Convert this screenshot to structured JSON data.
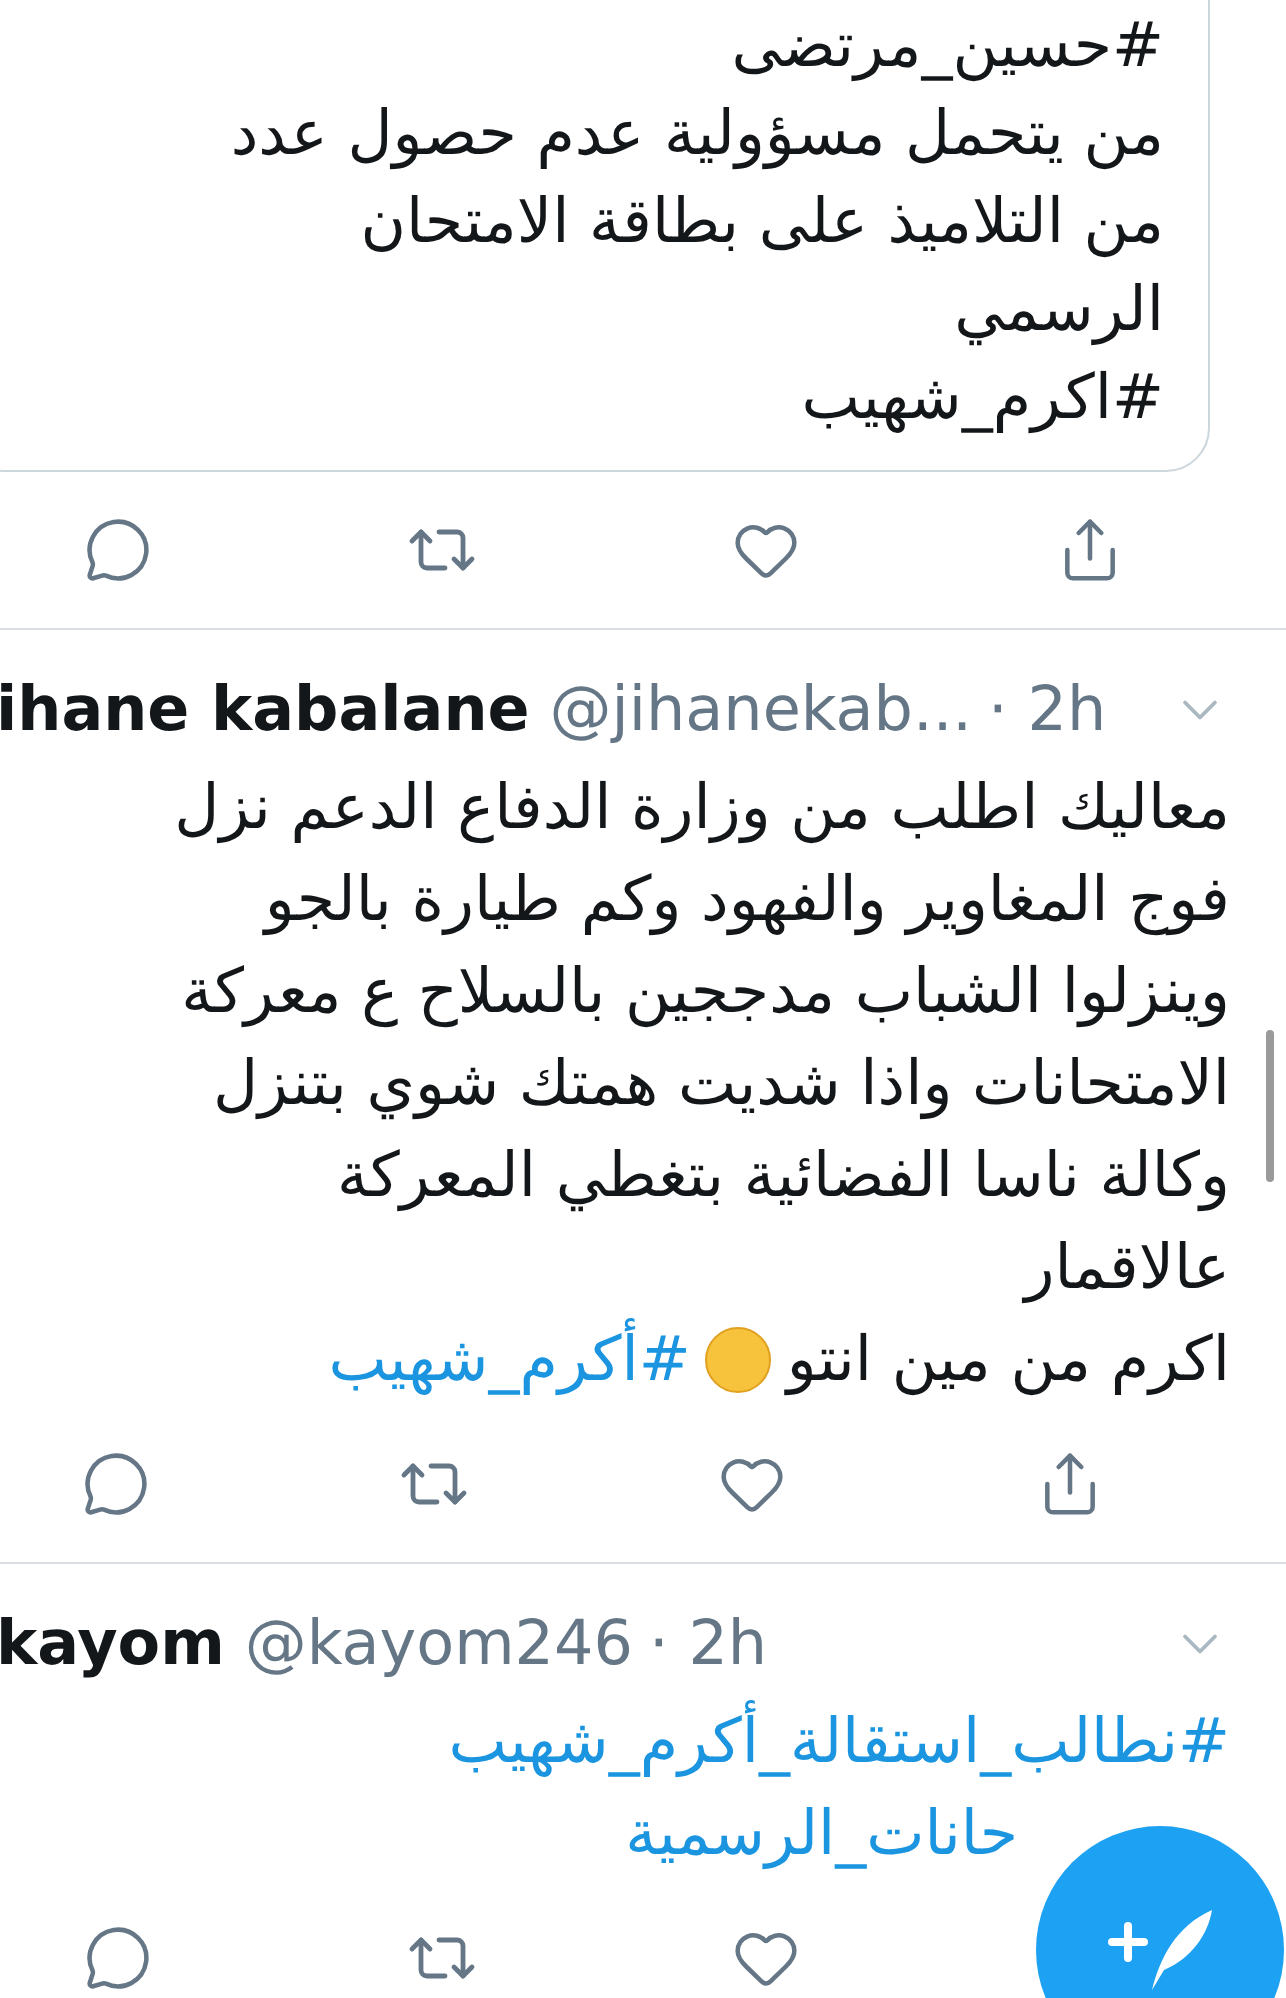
{
  "quoted_tweet": {
    "lines": [
      {
        "segments": [
          {
            "kind": "text",
            "text": "#حسين_مرتضى"
          }
        ]
      },
      {
        "segments": [
          {
            "kind": "text",
            "text": "من يتحمل مسؤولية عدم حصول عدد"
          }
        ]
      },
      {
        "segments": [
          {
            "kind": "text",
            "text": "من التلاميذ على بطاقة الامتحان"
          }
        ]
      },
      {
        "segments": [
          {
            "kind": "text",
            "text": "الرسمي"
          }
        ]
      },
      {
        "segments": [
          {
            "kind": "text",
            "text": "#اكرم_شهيب"
          }
        ]
      }
    ]
  },
  "tweets": [
    {
      "name": "ihane kabalane",
      "handle": "@jihanekab...",
      "time": "· 2h",
      "lines": [
        {
          "segments": [
            {
              "kind": "text",
              "text": "معاليك اطلب من وزارة الدفاع الدعم نزل"
            }
          ]
        },
        {
          "segments": [
            {
              "kind": "text",
              "text": "فوج المغاوير والفهود وكم طيارة بالجو"
            }
          ]
        },
        {
          "segments": [
            {
              "kind": "text",
              "text": "وينزلوا الشباب مدججين بالسلاح ع معركة"
            }
          ]
        },
        {
          "segments": [
            {
              "kind": "text",
              "text": "الامتحانات واذا شديت همتك شوي بتنزل"
            }
          ]
        },
        {
          "segments": [
            {
              "kind": "text",
              "text": "وكالة ناسا الفضائية بتغطي المعركة"
            }
          ]
        },
        {
          "segments": [
            {
              "kind": "text",
              "text": "عالاقمار"
            }
          ]
        },
        {
          "segments": [
            {
              "kind": "text",
              "text": "اكرم من مين انتو"
            },
            {
              "kind": "emoji"
            },
            {
              "kind": "hashtag",
              "text": "#أكرم_شهيب"
            }
          ]
        }
      ]
    },
    {
      "name": "kayom",
      "handle": "@kayom246",
      "time": "· 2h",
      "lines": [
        {
          "segments": [
            {
              "kind": "hashtag",
              "text": "#نطالب_استقالة_أكرم_شهيب"
            }
          ]
        },
        {
          "segments": [
            {
              "kind": "covered"
            },
            {
              "kind": "hashtag",
              "text": "حانات_الرسمية"
            }
          ]
        }
      ]
    }
  ]
}
